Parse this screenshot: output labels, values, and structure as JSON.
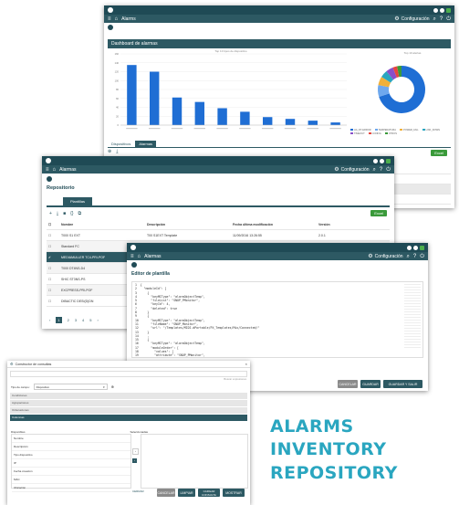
{
  "alarms_window": {
    "title": "Alarms",
    "config_label": "Configuración",
    "dashboard_header": "Dashboard de alarmas",
    "bar_chart_title": "Top 10 tipos de dispositivo",
    "donut_title": "Top 10 alertas",
    "tabs": [
      "Dispositivos",
      "Alarmas"
    ],
    "excel_label": "Excel",
    "side_column_header": "Última modificación",
    "side_rows": [
      "11/09/2016 09:00:00",
      "11/09/2016 09:00:00",
      "11/09/2016 09:00:00",
      "11/09/2016 09:00:00",
      "11/09/2016 09:00:00"
    ],
    "donut_legend": [
      "HA_DT-ERROR",
      "TEMPERATURA",
      "POWER_FAIL",
      "LINK_DOWN",
      "TIMEOUT",
      "CONFIG",
      "OTROS"
    ]
  },
  "chart_data": {
    "type": "bar",
    "title": "Top 10 tipos de dispositivo",
    "categories": [
      "",
      "",
      "",
      "",
      "",
      "",
      "",
      "",
      "",
      ""
    ],
    "values": [
      135,
      120,
      62,
      52,
      38,
      30,
      18,
      14,
      10,
      6
    ],
    "ylim": [
      0,
      160
    ],
    "yticks": [
      "0",
      "20",
      "40",
      "60",
      "80",
      "100",
      "120",
      "140",
      "160"
    ],
    "color": "#1f6ed4",
    "donut": {
      "values": [
        70,
        8,
        6,
        5,
        5,
        3,
        3
      ],
      "colors": [
        "#1f6ed4",
        "#6ea8ee",
        "#f0b03a",
        "#2aa6c0",
        "#8a4fc9",
        "#e8463f",
        "#3a9a3a"
      ]
    }
  },
  "repository_window": {
    "title": "Alarmas",
    "config_label": "Configuración",
    "page_title": "Repositorio",
    "tab_label": "Plantillas",
    "excel_label": "Excel",
    "columns": [
      "Nombre",
      "Descripción",
      "Fecha última modificación",
      "Versión"
    ],
    "rows": [
      {
        "name": "T000 S1 EXT",
        "desc": "T00 S1EXT Template",
        "date": "11/09/2016 13:26:55",
        "version": "2.0.1"
      },
      {
        "name": "Standard FC",
        "desc": "",
        "date": "",
        "version": ""
      },
      {
        "name": "MEDIAMULLER TC4-PRI-POF",
        "desc": "",
        "date": "",
        "version": ""
      },
      {
        "name": "T000 DT4NS-D4",
        "desc": "",
        "date": "",
        "version": ""
      },
      {
        "name": "SHIC ST3NS-PS",
        "desc": "",
        "date": "",
        "version": ""
      },
      {
        "name": "EXCPRESS-PRI-POF",
        "desc": "",
        "date": "",
        "version": ""
      },
      {
        "name": "DIBACTIC DESI(D)DN",
        "desc": "",
        "date": "",
        "version": ""
      }
    ],
    "pages": [
      "1",
      "2",
      "3",
      "4",
      "5"
    ]
  },
  "editor_window": {
    "title": "Alarmas",
    "config_label": "Configuración",
    "page_title": "Editor de plantilla",
    "code_lines": [
      "1  {",
      "2    \"moduleId\": [",
      "3      {",
      "4        \"keyMIType\": \"alarmObjectTemp\",",
      "5        \"fileList\": \"SNOP_PMonitor\",",
      "6        \"keyId\": 4,",
      "7        \"deleted\": true",
      "8      }",
      "9      {",
      "10       \"keyMIType\": \"alarmObjectTemp\",",
      "11       \"fileName\": \"SNOP_Monitor\",",
      "12       \"url\": \"/Templates/MIDI.dPortable/PX_Templates/Mix/Connected/\"",
      "13     }",
      "14     ,",
      "15     {",
      "16       \"keyMIType\": \"alarmObjectTemp\",",
      "17       \"moduleOrder\": [",
      "18         \"values\": [",
      "19         \"attribute\": \"SNOP_PMonitor\",",
      "20         \"type\": \"I\",",
      "21         \"deleted\": true",
      "22       ]",
      "23     }",
      "24   ]"
    ],
    "buttons": {
      "cancel": "CANCELAR",
      "save": "GUARDAR",
      "save_exit": "GUARDAR Y SALIR"
    }
  },
  "query_window": {
    "title": "Constructor de consultas",
    "search_hint": "Buscar expresiones",
    "field_label": "Tipo de campo:",
    "field_value": "Dispositivo",
    "sections": [
      "Condiciones",
      "Agrupaciones",
      "Ordenaciones",
      "Columnas"
    ],
    "left_header": "Disponibles",
    "right_header": "Seleccionadas",
    "left_items": [
      "Nombre",
      "Descripción",
      "Tipo dispositivo",
      "IP",
      "Fecha creación",
      "MAC",
      "Ubicación"
    ],
    "buttons": {
      "close": "CERRAR",
      "cancel": "CANCELAR",
      "clean": "LIMPIAR",
      "load": "CARGAR CONSULTA",
      "show": "MOSTRAR"
    }
  },
  "brand_lines": [
    "ALARMS",
    "INVENTORY",
    "REPOSITORY"
  ],
  "colors": {
    "header": "#1f4a55",
    "nav": "#2d5963",
    "accent": "#2aa6c0",
    "bar": "#1f6ed4",
    "green": "#3a9a3a"
  }
}
